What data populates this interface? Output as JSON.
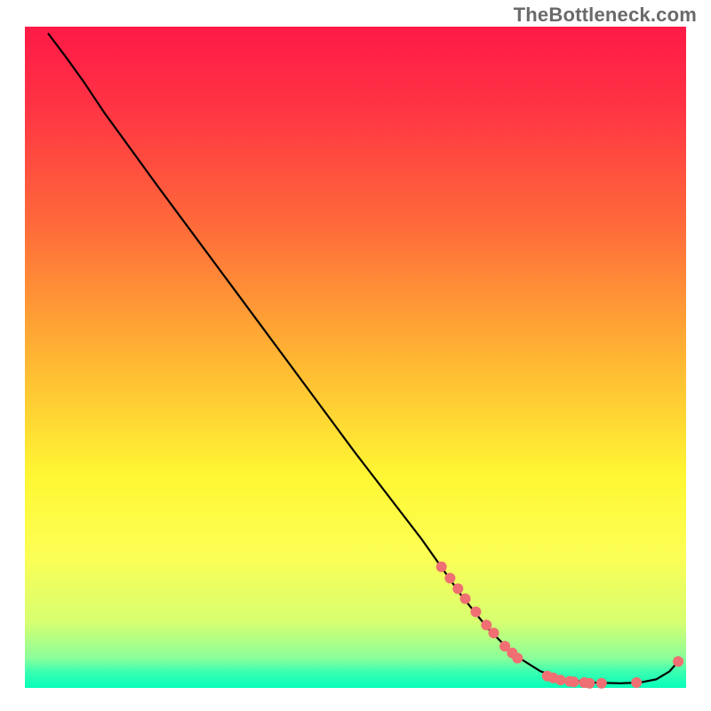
{
  "watermark": "TheBottleneck.com",
  "chart_data": {
    "type": "line",
    "title": "",
    "xlabel": "",
    "ylabel": "",
    "xlim": [
      0,
      100
    ],
    "ylim": [
      0,
      100
    ],
    "legend": false,
    "gradient_stops": [
      {
        "offset": 0.0,
        "color": "#ff1a47"
      },
      {
        "offset": 0.12,
        "color": "#ff3344"
      },
      {
        "offset": 0.3,
        "color": "#ff6a3a"
      },
      {
        "offset": 0.5,
        "color": "#ffb533"
      },
      {
        "offset": 0.68,
        "color": "#fff733"
      },
      {
        "offset": 0.8,
        "color": "#fcff55"
      },
      {
        "offset": 0.9,
        "color": "#d7ff70"
      },
      {
        "offset": 0.955,
        "color": "#8aff9a"
      },
      {
        "offset": 0.975,
        "color": "#3dffb0"
      },
      {
        "offset": 1.0,
        "color": "#06ffba"
      }
    ],
    "series": [
      {
        "name": "bottleneck-curve",
        "type": "line",
        "color": "#000000",
        "x": [
          3.5,
          6.5,
          9.0,
          12.0,
          20.0,
          30.0,
          40.0,
          50.0,
          60.0,
          66.0,
          70.0,
          74.0,
          78.0,
          82.0,
          86.0,
          90.0,
          93.0,
          95.5,
          97.5,
          98.8
        ],
        "y": [
          99.0,
          95.0,
          91.5,
          87.0,
          76.0,
          62.5,
          49.0,
          35.5,
          22.5,
          14.0,
          9.0,
          5.0,
          2.5,
          1.2,
          0.8,
          0.7,
          0.8,
          1.3,
          2.5,
          4.0
        ]
      },
      {
        "name": "bottleneck-markers",
        "type": "scatter",
        "color": "#ef6f72",
        "radius": 6,
        "x": [
          63.0,
          64.3,
          65.5,
          66.6,
          68.2,
          69.8,
          70.9,
          72.6,
          73.7,
          74.5,
          79.0,
          79.9,
          81.0,
          82.4,
          83.0,
          84.6,
          85.4,
          87.2,
          92.5,
          98.8
        ],
        "y": [
          18.3,
          16.6,
          15.0,
          13.5,
          11.5,
          9.5,
          8.3,
          6.3,
          5.3,
          4.5,
          1.8,
          1.5,
          1.2,
          1.0,
          0.9,
          0.8,
          0.7,
          0.7,
          0.8,
          4.0
        ]
      }
    ]
  }
}
